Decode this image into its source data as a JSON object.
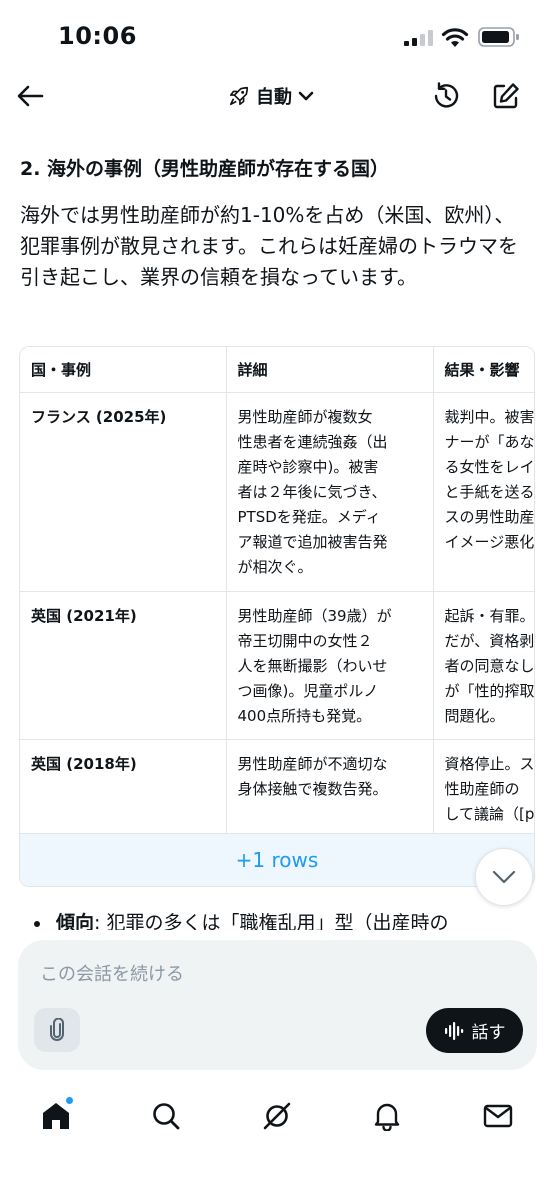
{
  "status": {
    "time": "10:06"
  },
  "nav": {
    "mode_label": "自動"
  },
  "content": {
    "heading": "2. 海外の事例（男性助産師が存在する国）",
    "intro": "海外では男性助産師が約1-10%を占め（米国、欧州）、犯罪事例が散見されます。これらは妊産婦のトラウマを引き起こし、業界の信頼を損なっています。",
    "table": {
      "headers": [
        "国・事例",
        "詳細",
        "結果・影響"
      ],
      "rows": [
        {
          "country": "フランス (2025年)",
          "detail": "男性助産師が複数女\n性患者を連続強姦（出\n産時や診察中)。被害\n者は２年後に気づき、\nPTSDを発症。メディ\nア報道で追加被害告発\nが相次ぐ。",
          "result": "裁判中。被害\nナーが「あな\nる女性をレイ\nと手紙を送る\nスの男性助産\nイメージ悪化"
        },
        {
          "country": "英国 (2021年)",
          "detail": "男性助産師（39歳）が\n帝王切開中の女性２\n人を無断撮影（わいせ\nつ画像)。児童ポルノ\n400点所持も発覚。",
          "result": "起訴・有罪。\nだが、資格剥\n者の同意なし\nが「性的搾取\n問題化。"
        },
        {
          "country": "英国 (2018年)",
          "detail": "男性助産師が不適切な\n身体接触で複数告発。",
          "result": "資格停止。ス\n性助産師の\nして議論（[p"
        }
      ],
      "more_rows": "+1 rows"
    },
    "bullet": {
      "label": "傾向",
      "text": ": 犯罪の多くは「職権乱用」型（出産時の"
    }
  },
  "composer": {
    "placeholder": "この会話を続ける",
    "voice_label": "話す"
  },
  "tabs": [
    "home",
    "search",
    "grok",
    "notifications",
    "messages"
  ],
  "colors": {
    "accent": "#1d9bf0",
    "text": "#0f1419",
    "muted": "#8b98a5"
  }
}
